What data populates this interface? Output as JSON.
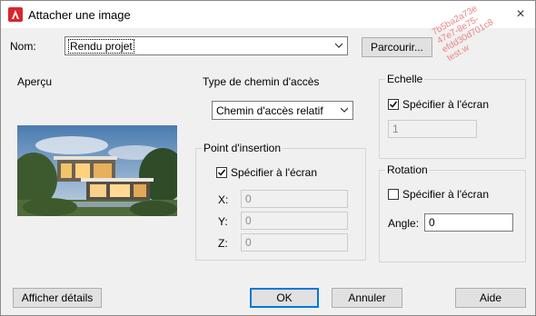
{
  "window": {
    "title": "Attacher une image",
    "close_glyph": "×"
  },
  "watermark": {
    "lines": [
      "7b5ba2a73e",
      "47e7-8e75-",
      "efdd30d701c8",
      "test.w"
    ]
  },
  "name": {
    "label": "Nom:",
    "value": "Rendu projet",
    "browse_label": "Parcourir..."
  },
  "preview": {
    "title": "Aperçu",
    "image": "house-render"
  },
  "path_type": {
    "title": "Type de chemin d'accès",
    "value": "Chemin d'accès relatif"
  },
  "insertion": {
    "title": "Point d'insertion",
    "specify_label": "Spécifier à l'écran",
    "specify_checked": true,
    "x_label": "X:",
    "x_value": "0",
    "y_label": "Y:",
    "y_value": "0",
    "z_label": "Z:",
    "z_value": "0"
  },
  "scale": {
    "title": "Echelle",
    "specify_label": "Spécifier à l'écran",
    "specify_checked": true,
    "value": "1"
  },
  "rotation": {
    "title": "Rotation",
    "specify_label": "Spécifier à l'écran",
    "specify_checked": false,
    "angle_label": "Angle:",
    "angle_value": "0"
  },
  "footer": {
    "details_label": "Afficher détails",
    "ok_label": "OK",
    "cancel_label": "Annuler",
    "help_label": "Aide"
  },
  "colors": {
    "accent": "#0078d7",
    "logo_red": "#d9262c"
  }
}
